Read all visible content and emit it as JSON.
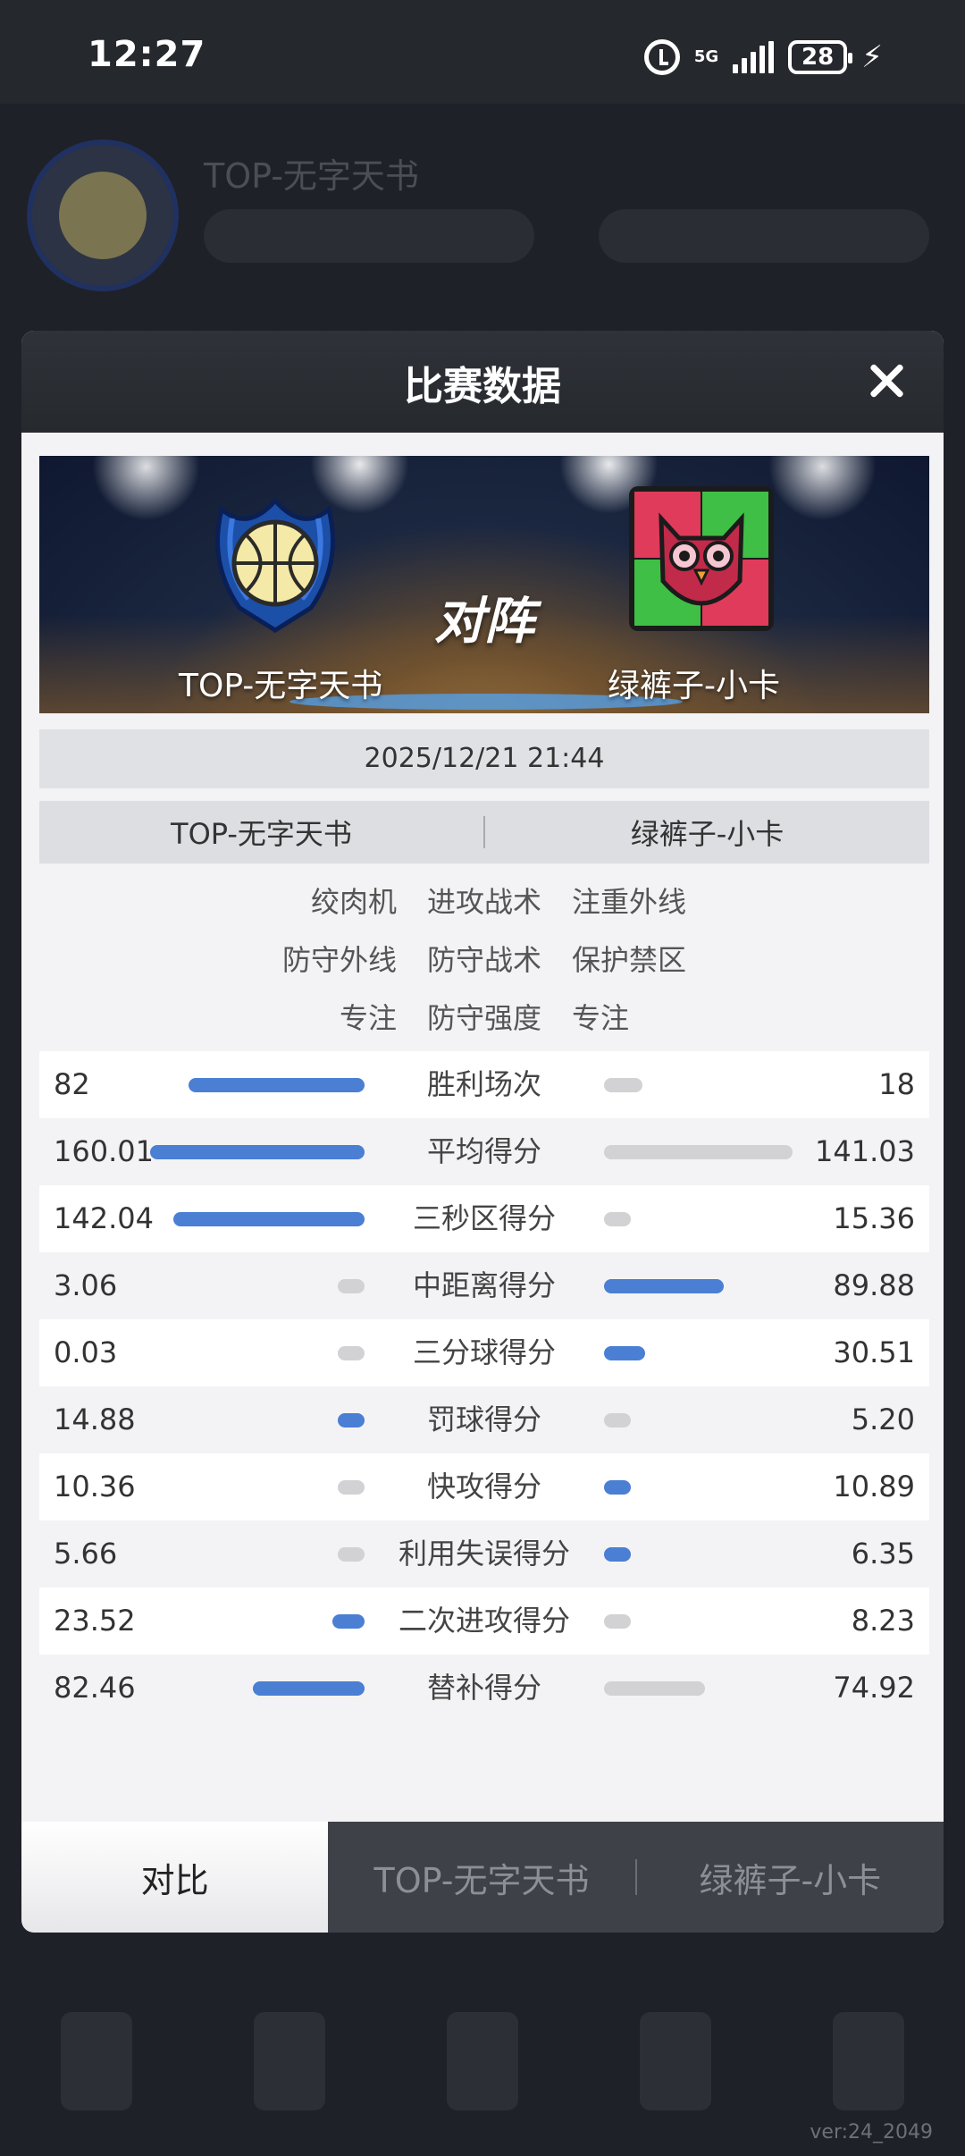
{
  "status_bar": {
    "time": "12:27",
    "network": "5G",
    "battery": "28"
  },
  "background_app": {
    "team_name": "TOP-无字天书",
    "version": "ver:24_2049"
  },
  "modal": {
    "title": "比赛数据",
    "vs_label": "对阵",
    "left_team": "TOP-无字天书",
    "right_team": "绿裤子-小卡",
    "datetime": "2025/12/21 21:44",
    "tactics": [
      {
        "left": "绞肉机",
        "label": "进攻战术",
        "right": "注重外线"
      },
      {
        "left": "防守外线",
        "label": "防守战术",
        "right": "保护禁区"
      },
      {
        "left": "专注",
        "label": "防守强度",
        "right": "专注"
      }
    ],
    "stats": [
      {
        "label": "胜利场次",
        "left": "82",
        "right": "18",
        "left_frac": 0.82,
        "right_frac": 0.18
      },
      {
        "label": "平均得分",
        "left": "160.01",
        "right": "141.03",
        "left_frac": 1.0,
        "right_frac": 0.88
      },
      {
        "label": "三秒区得分",
        "left": "142.04",
        "right": "15.36",
        "left_frac": 0.89,
        "right_frac": 0.1
      },
      {
        "label": "中距离得分",
        "left": "3.06",
        "right": "89.88",
        "left_frac": 0.02,
        "right_frac": 0.56
      },
      {
        "label": "三分球得分",
        "left": "0.03",
        "right": "30.51",
        "left_frac": 0.0,
        "right_frac": 0.19
      },
      {
        "label": "罚球得分",
        "left": "14.88",
        "right": "5.20",
        "left_frac": 0.09,
        "right_frac": 0.03
      },
      {
        "label": "快攻得分",
        "left": "10.36",
        "right": "10.89",
        "left_frac": 0.06,
        "right_frac": 0.07
      },
      {
        "label": "利用失误得分",
        "left": "5.66",
        "right": "6.35",
        "left_frac": 0.04,
        "right_frac": 0.04
      },
      {
        "label": "二次进攻得分",
        "left": "23.52",
        "right": "8.23",
        "left_frac": 0.15,
        "right_frac": 0.05
      },
      {
        "label": "替补得分",
        "left": "82.46",
        "right": "74.92",
        "left_frac": 0.52,
        "right_frac": 0.47
      }
    ],
    "tabs": [
      "对比",
      "TOP-无字天书",
      "绿裤子-小卡"
    ],
    "active_tab": 0
  },
  "colors": {
    "win_bar": "#4a7fd4",
    "lose_bar": "#d2d2d4",
    "header": "#2f3238"
  }
}
